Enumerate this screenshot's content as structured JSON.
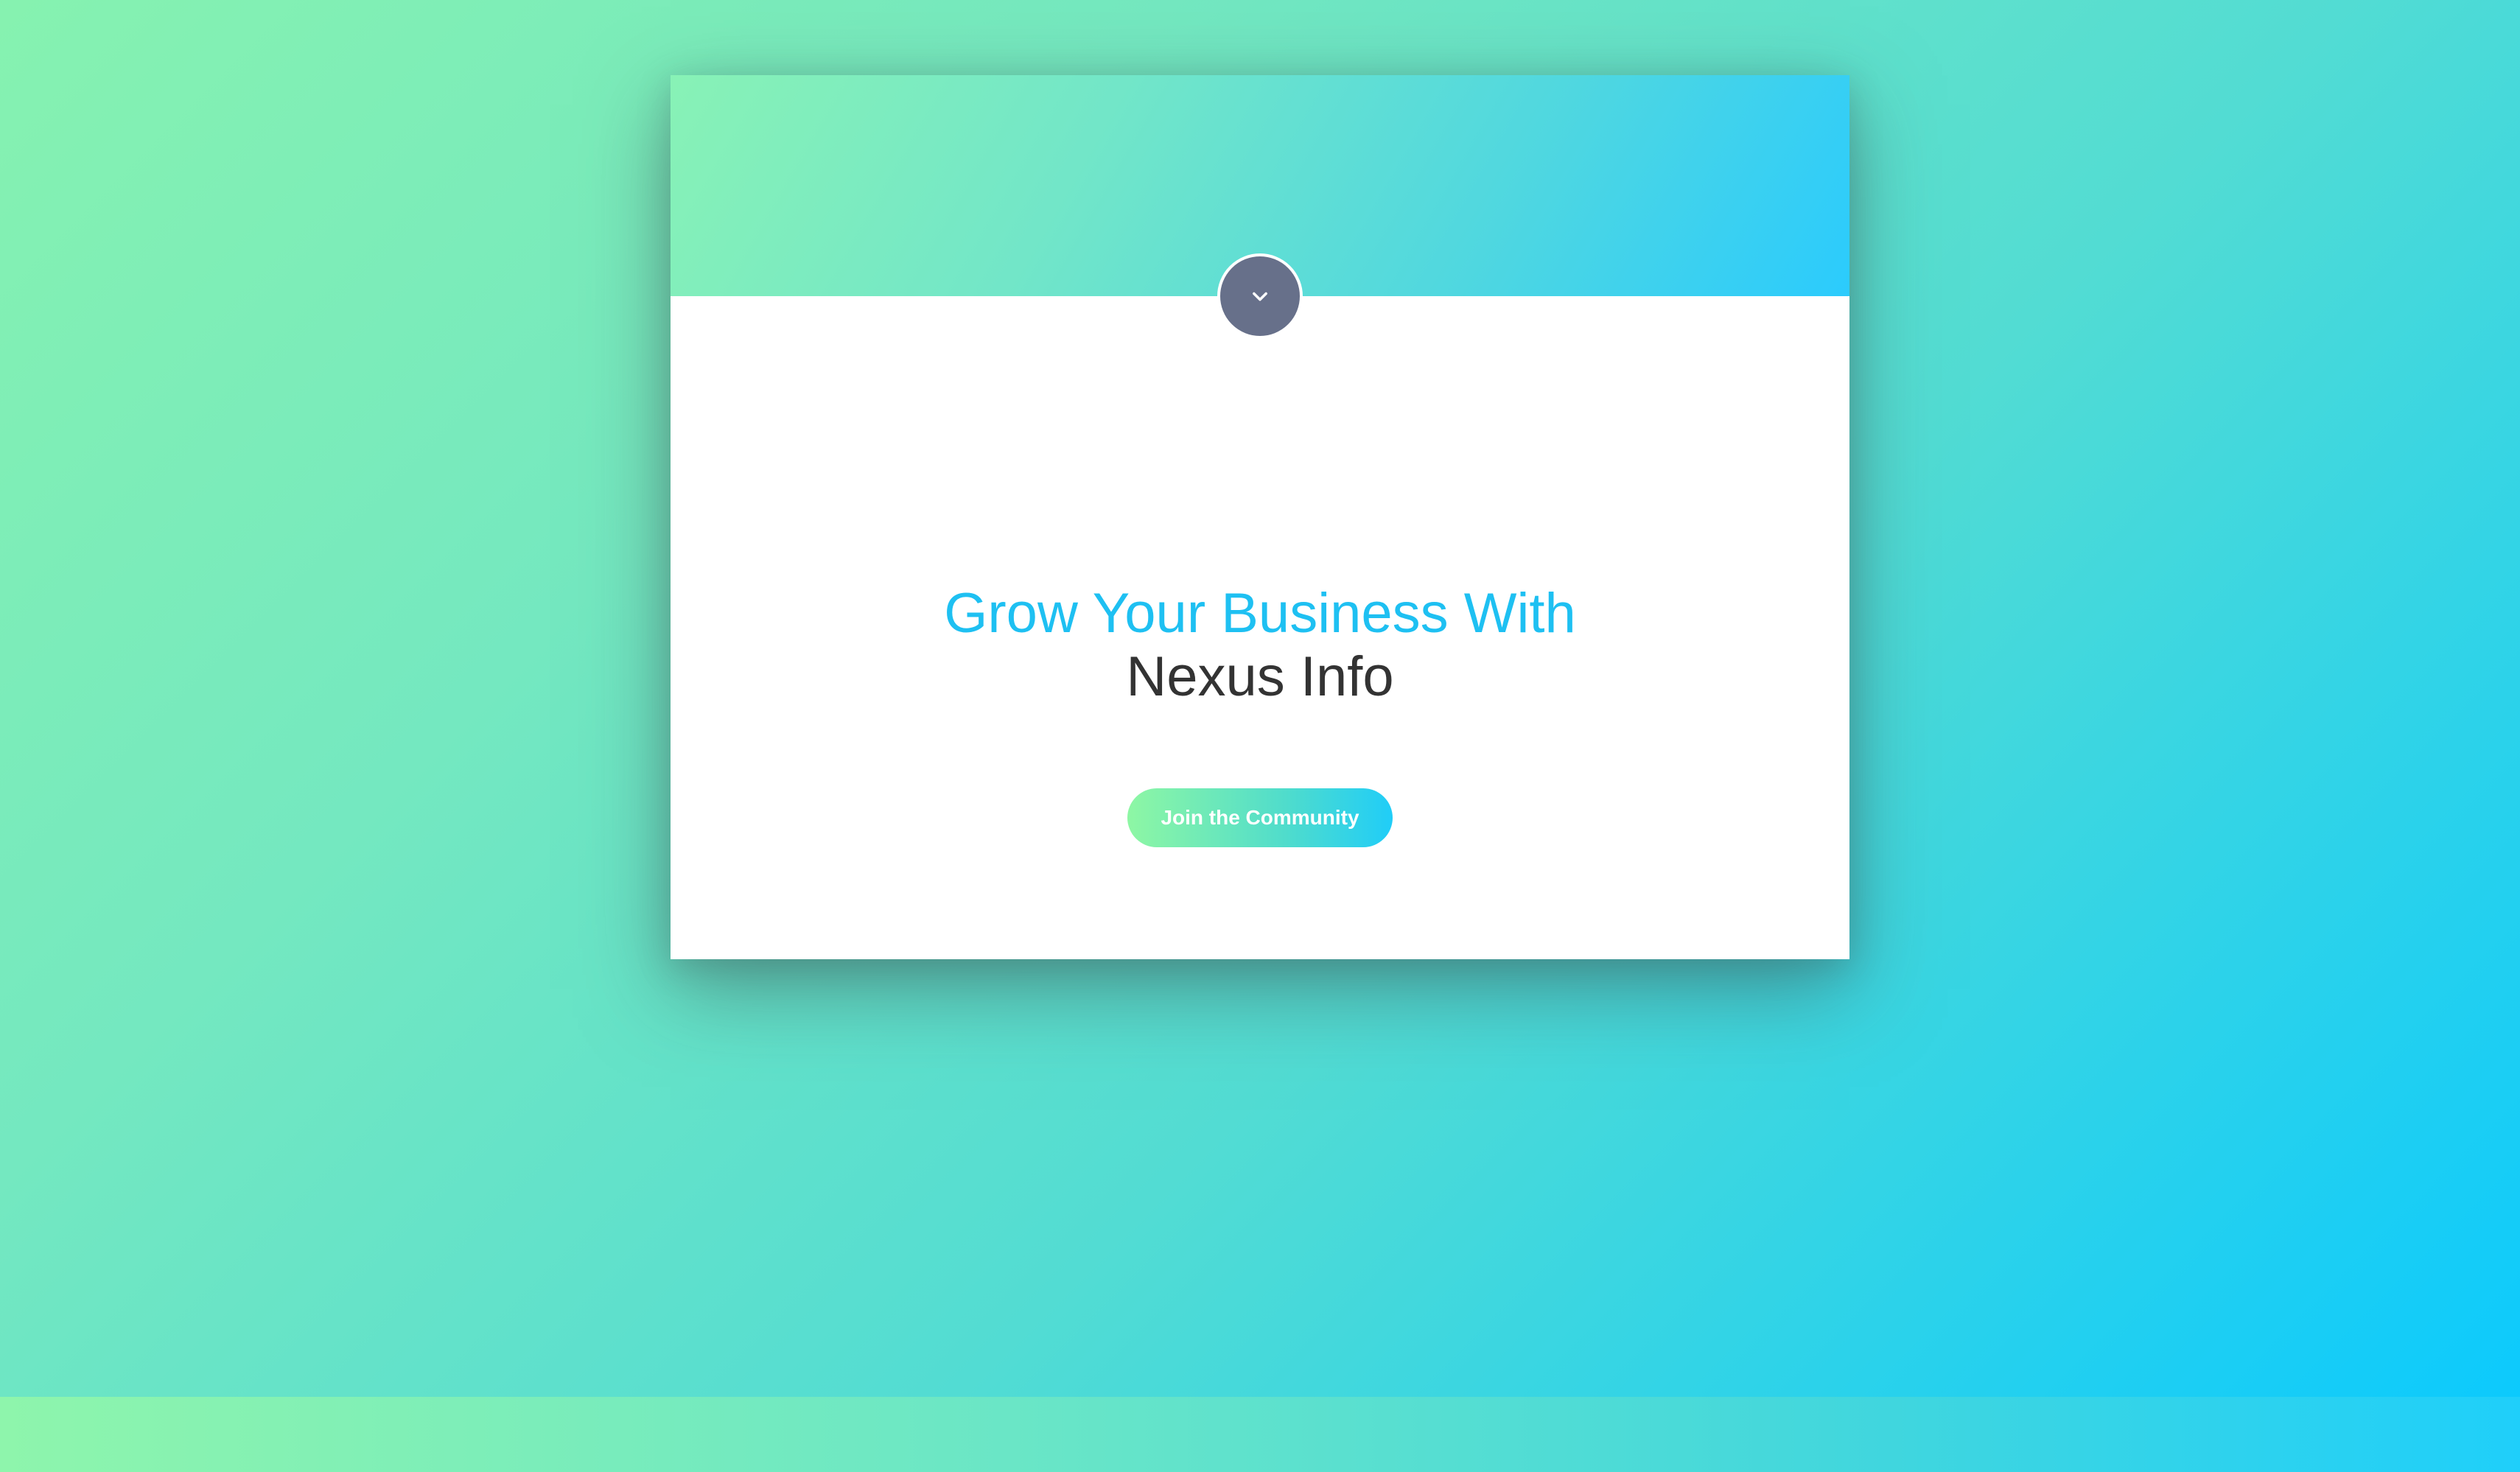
{
  "hero": {
    "headline_line1": "Grow Your Business With",
    "headline_line2": "Nexus Info",
    "cta_label": "Join the Community"
  },
  "header": {
    "toggle_icon": "chevron-down-icon"
  },
  "colors": {
    "accent_blue": "#1ec0f2",
    "headline_dark": "#333333",
    "toggle_bg": "#67708a",
    "gradient_start": "#86f2b0",
    "gradient_end": "#0ccafd"
  }
}
